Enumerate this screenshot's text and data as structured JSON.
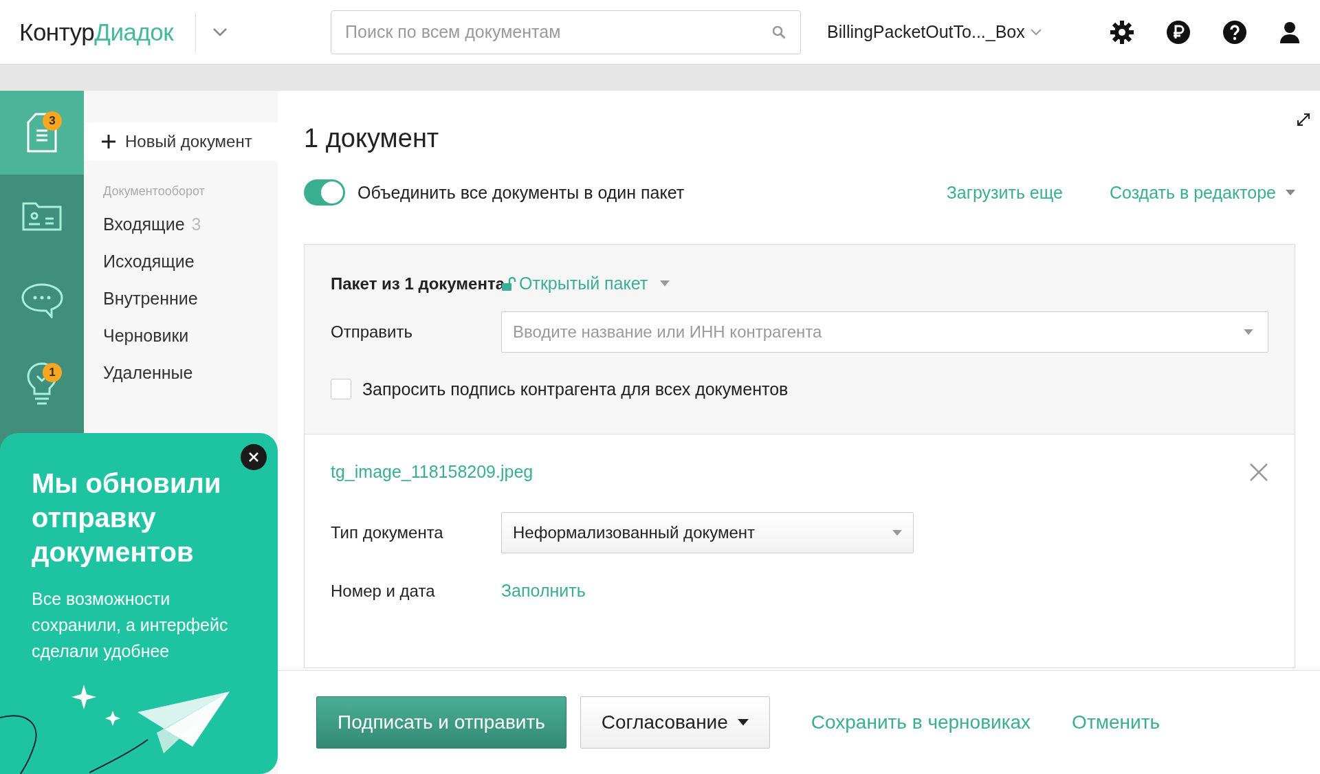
{
  "header": {
    "logo_dark": "Контур",
    "logo_accent": "Диадок",
    "search": {
      "placeholder": "Поиск по всем документам"
    },
    "account": "BillingPacketOutTo..._Box"
  },
  "rail": [
    {
      "kind": "documents",
      "selected": true,
      "badge": "3"
    },
    {
      "kind": "contacts",
      "selected": false
    },
    {
      "kind": "chat",
      "selected": false
    },
    {
      "kind": "ideas",
      "selected": false,
      "badge": "1"
    }
  ],
  "nav": {
    "new_button": "Новый документ",
    "section": "Документооборот",
    "items": [
      {
        "label": "Входящие",
        "count": "3"
      },
      {
        "label": "Исходящие"
      },
      {
        "label": "Внутренние"
      },
      {
        "label": "Черновики"
      },
      {
        "label": "Удаленные"
      }
    ]
  },
  "main": {
    "title": "1 документ",
    "merge_toggle": {
      "label": "Объединить все документы в один пакет",
      "on": true
    },
    "upload_link": "Загрузить еще",
    "create_link": "Создать в редакторе",
    "package": {
      "title": "Пакет из 1 документа",
      "type_link": "Открытый пакет",
      "send_label": "Отправить",
      "recipient": {
        "placeholder": "Вводите название или ИНН контрагента"
      },
      "request_signature": {
        "label": "Запросить подпись контрагента для всех документов",
        "checked": false
      }
    },
    "document": {
      "file_name": "tg_image_118158209.jpeg",
      "fields": [
        {
          "kind": "select",
          "label": "Тип документа",
          "value": "Неформализованный документ"
        },
        {
          "kind": "link",
          "label": "Номер и дата",
          "value": "Заполнить"
        }
      ]
    }
  },
  "footer": {
    "buttons": [
      {
        "kind": "primary",
        "label": "Подписать и отправить"
      },
      {
        "kind": "dropdown",
        "label": "Согласование"
      },
      {
        "kind": "link",
        "label": "Сохранить в черновиках"
      },
      {
        "kind": "link",
        "label": "Отменить"
      }
    ]
  },
  "promo": {
    "title": "Мы обновили отправку документов",
    "text": "Все возможности сохранили, а интерфейс сделали удобнее"
  }
}
